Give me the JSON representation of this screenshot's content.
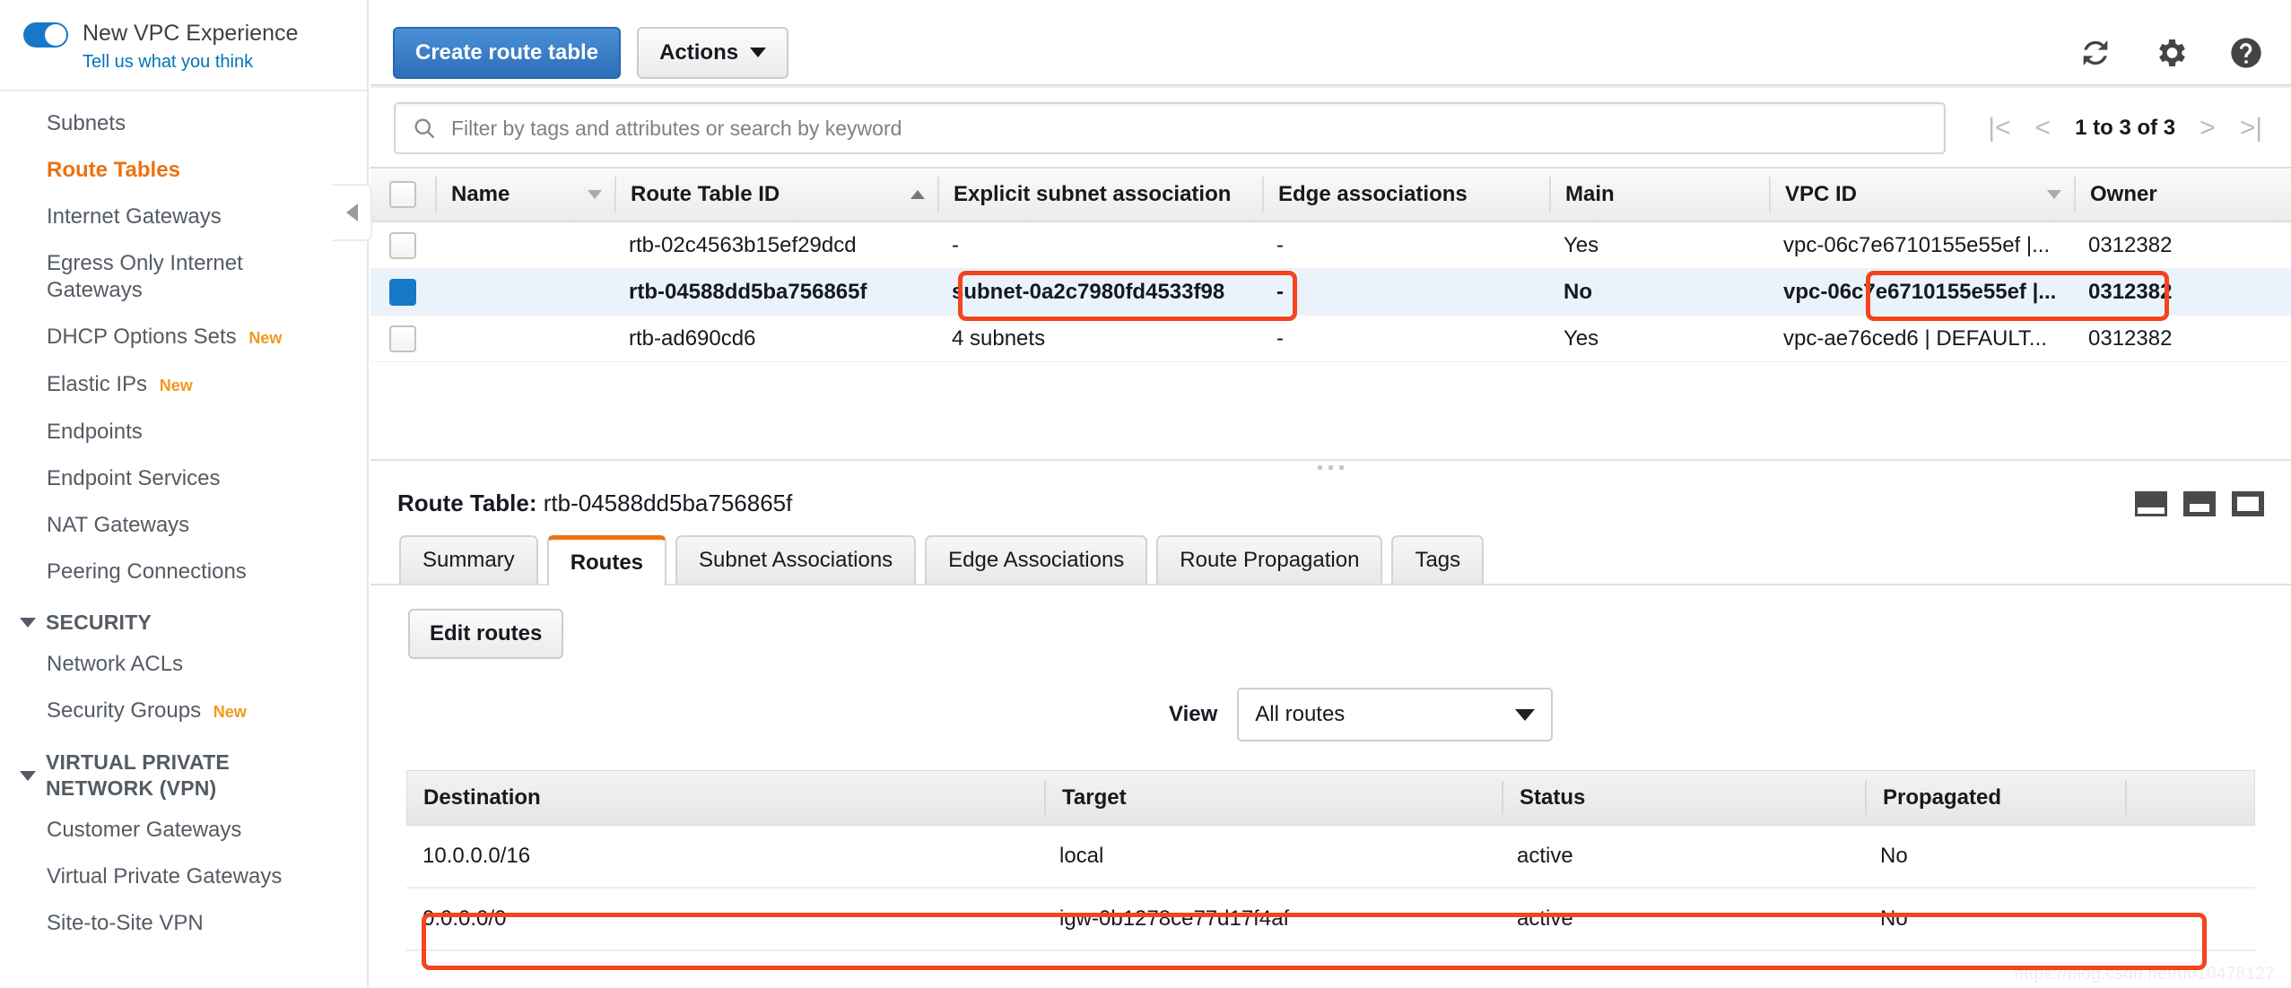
{
  "sidebar": {
    "vpc_experience": {
      "title": "New VPC Experience",
      "feedback_link": "Tell us what you think",
      "toggle_on": true
    },
    "items": [
      {
        "label": "Subnets",
        "badge": "",
        "active": false
      },
      {
        "label": "Route Tables",
        "badge": "",
        "active": true
      },
      {
        "label": "Internet Gateways",
        "badge": "",
        "active": false
      },
      {
        "label": "Egress Only Internet Gateways",
        "badge": "",
        "active": false
      },
      {
        "label": "DHCP Options Sets",
        "badge": "New",
        "active": false
      },
      {
        "label": "Elastic IPs",
        "badge": "New",
        "active": false
      },
      {
        "label": "Endpoints",
        "badge": "",
        "active": false
      },
      {
        "label": "Endpoint Services",
        "badge": "",
        "active": false
      },
      {
        "label": "NAT Gateways",
        "badge": "",
        "active": false
      },
      {
        "label": "Peering Connections",
        "badge": "",
        "active": false
      }
    ],
    "security_group": {
      "title": "SECURITY",
      "items": [
        {
          "label": "Network ACLs",
          "badge": ""
        },
        {
          "label": "Security Groups",
          "badge": "New"
        }
      ]
    },
    "vpn_group": {
      "title": "VIRTUAL PRIVATE NETWORK (VPN)",
      "items": [
        {
          "label": "Customer Gateways",
          "badge": ""
        },
        {
          "label": "Virtual Private Gateways",
          "badge": ""
        },
        {
          "label": "Site-to-Site VPN",
          "badge": ""
        }
      ]
    }
  },
  "toolbar": {
    "create_label": "Create route table",
    "actions_label": "Actions",
    "refresh_icon": "refresh-icon",
    "settings_icon": "gear-icon",
    "help_icon": "help-icon"
  },
  "search": {
    "placeholder": "Filter by tags and attributes or search by keyword",
    "value": "",
    "icon": "search-icon"
  },
  "pagination": {
    "first": "|<",
    "prev": "<",
    "range": "1 to 3 of 3",
    "next": ">",
    "last": ">|"
  },
  "route_tables": {
    "columns": [
      "Name",
      "Route Table ID",
      "Explicit subnet association",
      "Edge associations",
      "Main",
      "VPC ID",
      "Owner"
    ],
    "sort_column": "Route Table ID",
    "sort_direction": "asc",
    "rows": [
      {
        "selected": false,
        "name": "",
        "route_table_id": "rtb-02c4563b15ef29dcd",
        "subnet_association": "-",
        "subnet_is_link": false,
        "edge_associations": "-",
        "main": "Yes",
        "vpc_id": "vpc-06c7e6710155e55ef |...",
        "owner": "0312382"
      },
      {
        "selected": true,
        "name": "",
        "route_table_id": "rtb-04588dd5ba756865f",
        "subnet_association": "subnet-0a2c7980fd4533f98",
        "subnet_is_link": false,
        "edge_associations": "-",
        "main": "No",
        "vpc_id": "vpc-06c7e6710155e55ef |...",
        "owner": "0312382"
      },
      {
        "selected": false,
        "name": "",
        "route_table_id": "rtb-ad690cd6",
        "subnet_association": "4 subnets",
        "subnet_is_link": true,
        "edge_associations": "-",
        "main": "Yes",
        "vpc_id": "vpc-ae76ced6 | DEFAULT...",
        "owner": "0312382"
      }
    ]
  },
  "detail": {
    "title_label": "Route Table:",
    "title_value": "rtb-04588dd5ba756865f",
    "panel_icons": [
      "panel-bottom-small-icon",
      "panel-bottom-medium-icon",
      "panel-full-icon"
    ],
    "tabs": [
      {
        "label": "Summary",
        "active": false
      },
      {
        "label": "Routes",
        "active": true
      },
      {
        "label": "Subnet Associations",
        "active": false
      },
      {
        "label": "Edge Associations",
        "active": false
      },
      {
        "label": "Route Propagation",
        "active": false
      },
      {
        "label": "Tags",
        "active": false
      }
    ],
    "edit_routes_label": "Edit routes",
    "view_label": "View",
    "view_selected": "All routes"
  },
  "routes_table": {
    "columns": [
      "Destination",
      "Target",
      "Status",
      "Propagated"
    ],
    "rows": [
      {
        "destination": "10.0.0.0/16",
        "target": "local",
        "target_is_link": false,
        "status": "active",
        "propagated": "No",
        "highlighted": false
      },
      {
        "destination": "0.0.0.0/0",
        "target": "igw-0b1278ce77d17f4af",
        "target_is_link": true,
        "status": "active",
        "propagated": "No",
        "highlighted": true
      }
    ]
  },
  "watermark": "https://blog.csdn.net/u010478127",
  "colors": {
    "accent_orange": "#ec7211",
    "link_blue": "#0073bb",
    "primary_blue": "#2d6eb8",
    "status_green": "#1d8102",
    "highlight_red": "#f4441e"
  }
}
